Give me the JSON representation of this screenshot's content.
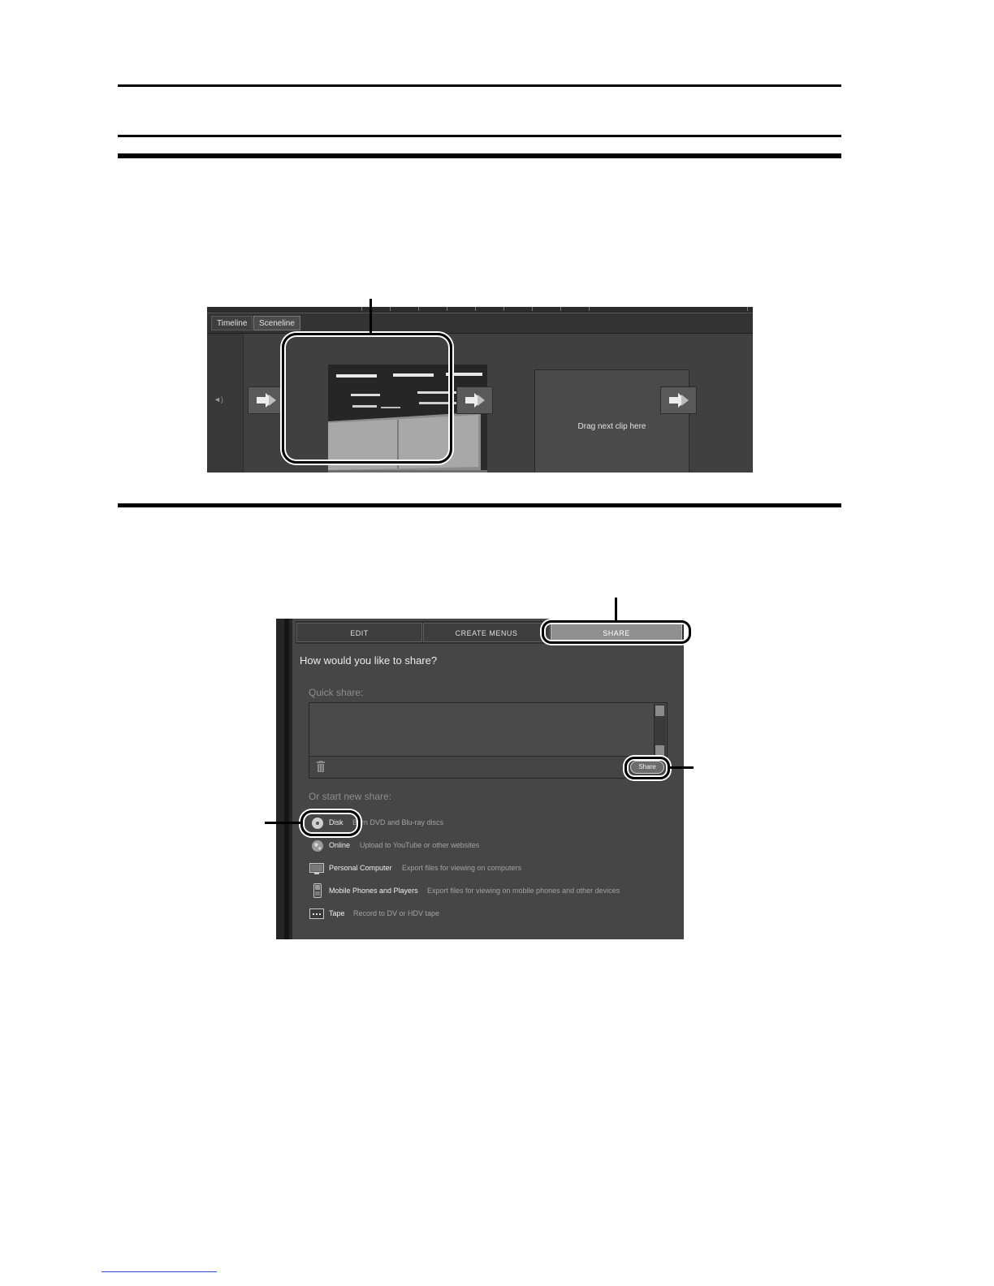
{
  "sceneline": {
    "tabs": [
      "Timeline",
      "Sceneline"
    ],
    "drop_zone_text": "Drag next clip here",
    "speaker_label": "◄)"
  },
  "share_panel": {
    "tabs": [
      "EDIT",
      "CREATE MENUS",
      "SHARE"
    ],
    "active_tab": "SHARE",
    "heading": "How would you like to share?",
    "quick_share_label": "Quick share:",
    "share_button_label": "Share",
    "new_share_label": "Or start new share:",
    "options": [
      {
        "label": "Disk",
        "description": "Burn DVD and Blu-ray discs",
        "icon": "disc-icon"
      },
      {
        "label": "Online",
        "description": "Upload to YouTube or other websites",
        "icon": "globe-icon"
      },
      {
        "label": "Personal Computer",
        "description": "Export files for viewing on computers",
        "icon": "monitor-icon"
      },
      {
        "label": "Mobile Phones and Players",
        "description": "Export files for viewing on mobile phones and other devices",
        "icon": "mobile-phone-icon"
      },
      {
        "label": "Tape",
        "description": "Record to DV or HDV tape",
        "icon": "tape-icon"
      }
    ]
  },
  "colors": {
    "panel_bg": "#464646",
    "sceneline_bg": "#404040",
    "active_tab": "#8f8f8f"
  }
}
